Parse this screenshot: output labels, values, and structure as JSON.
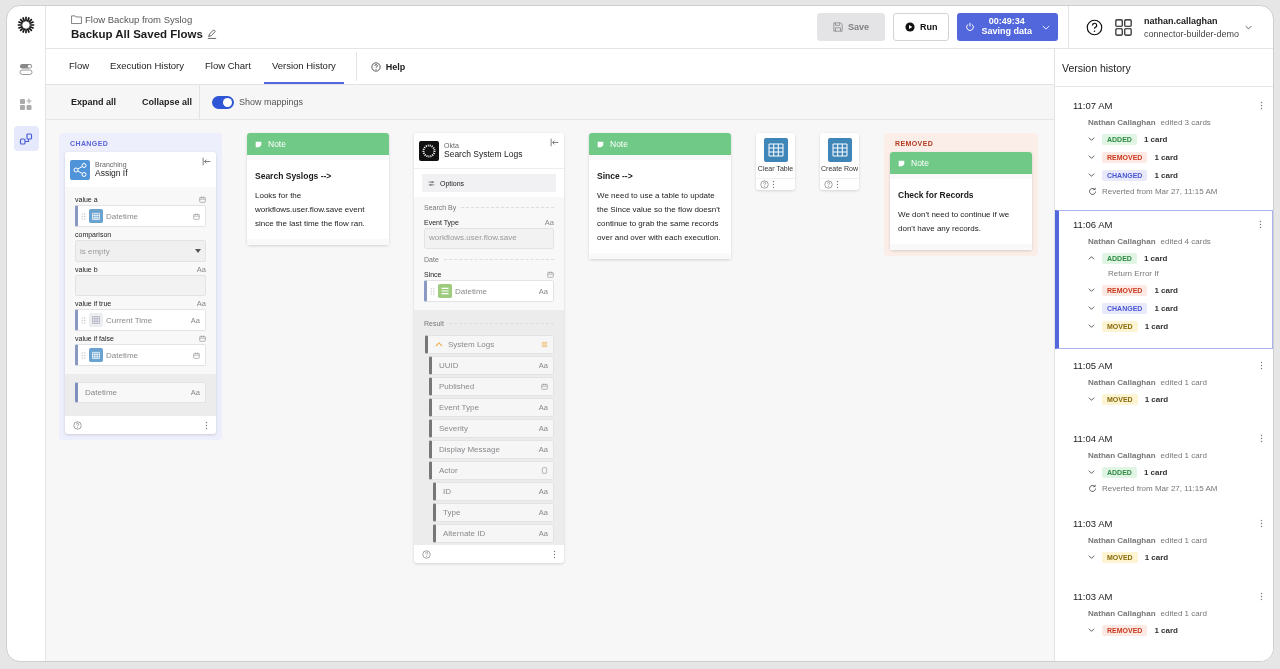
{
  "rail": [
    {
      "kind": "toggles",
      "selected": false
    },
    {
      "kind": "add",
      "selected": false
    },
    {
      "kind": "flows",
      "selected": true
    }
  ],
  "header": {
    "breadcrumb": "Flow Backup from Syslog",
    "title": "Backup All Saved Flows",
    "save": {
      "label": "Save",
      "disabled": true
    },
    "run": {
      "label": "Run"
    },
    "timer": {
      "time": "00:49:34",
      "status": "Saving data"
    },
    "user": {
      "name": "nathan.callaghan",
      "org": "connector-builder-demo"
    }
  },
  "tabs": [
    {
      "label": "Flow",
      "selected": false
    },
    {
      "label": "Execution History",
      "selected": false
    },
    {
      "label": "Flow Chart",
      "selected": false
    },
    {
      "label": "Version History",
      "selected": true
    }
  ],
  "help": "Help",
  "toolbar": {
    "expand": "Expand all",
    "collapse": "Collapse all",
    "mappings": {
      "label": "Show mappings",
      "on": true
    }
  },
  "canvas": {
    "cards": [
      {
        "kind": "function",
        "status": {
          "kind": "changed",
          "label": "CHANGED"
        },
        "category": "Branching",
        "name": "Assign If",
        "inputs": [
          {
            "label": "value a",
            "type": {
              "kind": "date"
            },
            "control": {
              "kind": "table_pill",
              "label": "Datetime",
              "type": {
                "kind": "date"
              }
            }
          },
          {
            "label": "comparison",
            "control": {
              "kind": "select",
              "value": "is empty"
            }
          },
          {
            "label": "value b",
            "type": {
              "kind": "text",
              "label": "Aa"
            },
            "control": {
              "kind": "textarea"
            }
          },
          {
            "label": "value if true",
            "type": {
              "kind": "text",
              "label": "Aa"
            },
            "control": {
              "kind": "grid_pill",
              "label": "Current Time",
              "type": {
                "kind": "text",
                "label": "Aa"
              }
            }
          },
          {
            "label": "value if false",
            "type": {
              "kind": "date"
            },
            "control": {
              "kind": "table_pill",
              "label": "Datetime",
              "type": {
                "kind": "date"
              }
            }
          }
        ],
        "outputs": [
          {
            "label": "Datetime",
            "type": {
              "kind": "text",
              "label": "Aa"
            }
          }
        ]
      },
      {
        "kind": "note",
        "header": "Note",
        "title": "Search Syslogs -->",
        "body": "Looks for the workflows.user.flow.save event since the last time the flow ran."
      },
      {
        "kind": "connector",
        "app": "Okta",
        "name": "Search System Logs",
        "options": "Options",
        "sections": [
          {
            "title": "Search By",
            "fields": [
              {
                "label": "Event Type",
                "type": {
                  "kind": "text",
                  "label": "Aa"
                },
                "control": {
                  "kind": "textarea",
                  "value": "workflows.user.flow.save"
                }
              }
            ]
          },
          {
            "title": "Date",
            "fields": [
              {
                "label": "Since",
                "type": {
                  "kind": "date"
                },
                "control": {
                  "kind": "list_pill",
                  "label": "Datetime",
                  "type": {
                    "kind": "text",
                    "label": "Aa"
                  }
                }
              }
            ]
          }
        ],
        "result": {
          "title": "Result",
          "outputs": [
            {
              "label": "System Logs",
              "expanded": true,
              "type": {
                "kind": "list"
              },
              "children": [
                {
                  "label": "UUID",
                  "type": {
                    "kind": "text",
                    "label": "Aa"
                  }
                },
                {
                  "label": "Published",
                  "type": {
                    "kind": "date"
                  }
                },
                {
                  "label": "Event Type",
                  "type": {
                    "kind": "text",
                    "label": "Aa"
                  }
                },
                {
                  "label": "Severity",
                  "type": {
                    "kind": "text",
                    "label": "Aa"
                  }
                },
                {
                  "label": "Display Message",
                  "type": {
                    "kind": "text",
                    "label": "Aa"
                  }
                },
                {
                  "label": "Actor",
                  "type": {
                    "kind": "object"
                  },
                  "children": [
                    {
                      "label": "ID",
                      "type": {
                        "kind": "text",
                        "label": "Aa"
                      }
                    },
                    {
                      "label": "Type",
                      "type": {
                        "kind": "text",
                        "label": "Aa"
                      }
                    },
                    {
                      "label": "Alternate ID",
                      "type": {
                        "kind": "text",
                        "label": "Aa"
                      }
                    }
                  ]
                }
              ]
            }
          ]
        }
      },
      {
        "kind": "note",
        "header": "Note",
        "title": "Since -->",
        "body": "We need to use a table to update the Since value so the flow doesn't continue to grab the same records over and over with each execution."
      },
      {
        "kind": "action",
        "name": "Clear Table"
      },
      {
        "kind": "action",
        "name": "Create Row"
      },
      {
        "kind": "note",
        "status": {
          "kind": "removed",
          "label": "REMOVED"
        },
        "header": "Note",
        "title": "Check for Records",
        "body": "We don't need to continue if we don't have any records."
      }
    ]
  },
  "version_history": {
    "title": "Version history",
    "entries": [
      {
        "time": "11:07 AM",
        "author": "Nathan Callaghan",
        "summary": "edited 3 cards",
        "selected": false,
        "changes": [
          {
            "kind": "added",
            "badge": "ADDED",
            "count": "1 card",
            "expanded": false
          },
          {
            "kind": "removed",
            "badge": "REMOVED",
            "count": "1 card",
            "expanded": false
          },
          {
            "kind": "changed",
            "badge": "CHANGED",
            "count": "1 card",
            "expanded": false
          }
        ],
        "reverted": "Reverted from Mar 27, 11:15 AM"
      },
      {
        "time": "11:06 AM",
        "author": "Nathan Callaghan",
        "summary": "edited 4 cards",
        "selected": true,
        "changes": [
          {
            "kind": "added",
            "badge": "ADDED",
            "count": "1 card",
            "expanded": true,
            "items": [
              "Return Error If"
            ]
          },
          {
            "kind": "removed",
            "badge": "REMOVED",
            "count": "1 card",
            "expanded": false
          },
          {
            "kind": "changed",
            "badge": "CHANGED",
            "count": "1 card",
            "expanded": false
          },
          {
            "kind": "moved",
            "badge": "MOVED",
            "count": "1 card",
            "expanded": false
          }
        ]
      },
      {
        "time": "11:05 AM",
        "author": "Nathan Callaghan",
        "summary": "edited 1 card",
        "selected": false,
        "changes": [
          {
            "kind": "moved",
            "badge": "MOVED",
            "count": "1 card",
            "expanded": false
          }
        ]
      },
      {
        "time": "11:04 AM",
        "author": "Nathan Callaghan",
        "summary": "edited 1 card",
        "selected": false,
        "changes": [
          {
            "kind": "added",
            "badge": "ADDED",
            "count": "1 card",
            "expanded": false
          }
        ],
        "reverted": "Reverted from Mar 27, 11:15 AM"
      },
      {
        "time": "11:03 AM",
        "author": "Nathan Callaghan",
        "summary": "edited 1 card",
        "selected": false,
        "changes": [
          {
            "kind": "moved",
            "badge": "MOVED",
            "count": "1 card",
            "expanded": false
          }
        ]
      },
      {
        "time": "11:03 AM",
        "author": "Nathan Callaghan",
        "summary": "edited 1 card",
        "selected": false,
        "changes": [
          {
            "kind": "removed",
            "badge": "REMOVED",
            "count": "1 card",
            "expanded": false
          }
        ]
      }
    ]
  }
}
